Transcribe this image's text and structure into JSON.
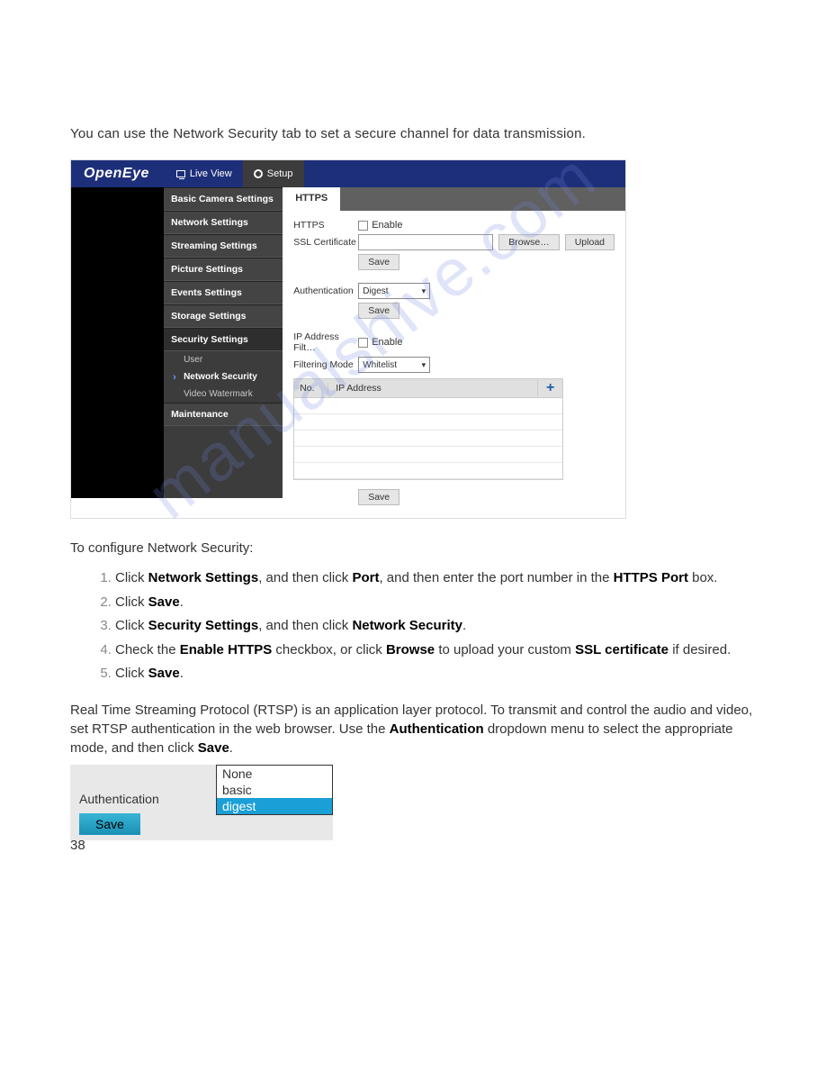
{
  "intro": "You can use the Network Security tab to set a secure channel for data transmission.",
  "brand": "OpenEye",
  "topnav": {
    "liveview": "Live View",
    "setup": "Setup"
  },
  "menu": {
    "basic": "Basic Camera Settings",
    "network": "Network Settings",
    "streaming": "Streaming Settings",
    "picture": "Picture Settings",
    "events": "Events Settings",
    "storage": "Storage Settings",
    "security": "Security Settings",
    "sub_user": "User",
    "sub_netsec": "Network Security",
    "sub_video": "Video Watermark",
    "maintenance": "Maintenance"
  },
  "tab": "HTTPS",
  "form": {
    "https_label": "HTTPS",
    "enable_label": "Enable",
    "ssl_label": "SSL Certificate",
    "browse": "Browse…",
    "upload": "Upload",
    "save": "Save",
    "auth_label": "Authentication",
    "auth_value": "Digest",
    "ipfilt_label": "IP Address Filt…",
    "filtmode_label": "Filtering Mode",
    "filtmode_value": "Whitelist",
    "col_no": "No.",
    "col_ip": "IP Address",
    "plus": "+"
  },
  "subhead": "To configure Network Security:",
  "steps": {
    "s1a": "Click ",
    "s1b": "Network Settings",
    "s1c": ", and then click ",
    "s1d": "Port",
    "s1e": ", and then enter the port number in the ",
    "s1f": "HTTPS Port",
    "s1g": " box.",
    "s2a": "Click ",
    "s2b": "Save",
    "s2c": ".",
    "s3a": "Click ",
    "s3b": "Security Settings",
    "s3c": ", and then click ",
    "s3d": "Network Security",
    "s3e": ".",
    "s4a": "Check the ",
    "s4b": "Enable HTTPS",
    "s4c": " checkbox, or click ",
    "s4d": "Browse",
    "s4e": " to upload your custom ",
    "s4f": "SSL certificate",
    "s4g": " if desired.",
    "s5a": "Click ",
    "s5b": "Save",
    "s5c": "."
  },
  "para": {
    "p1": "Real Time Streaming Protocol (RTSP) is an application layer protocol. To transmit and control the audio and video, set RTSP authentication in the web browser. Use the ",
    "p2": "Authentication",
    "p3": " dropdown menu to select the appropriate mode, and then click ",
    "p4": "Save",
    "p5": "."
  },
  "widget": {
    "label": "Authentication",
    "save": "Save",
    "opts": [
      "None",
      "basic",
      "digest"
    ]
  },
  "pageno": "38",
  "watermark": "manualshive.com"
}
